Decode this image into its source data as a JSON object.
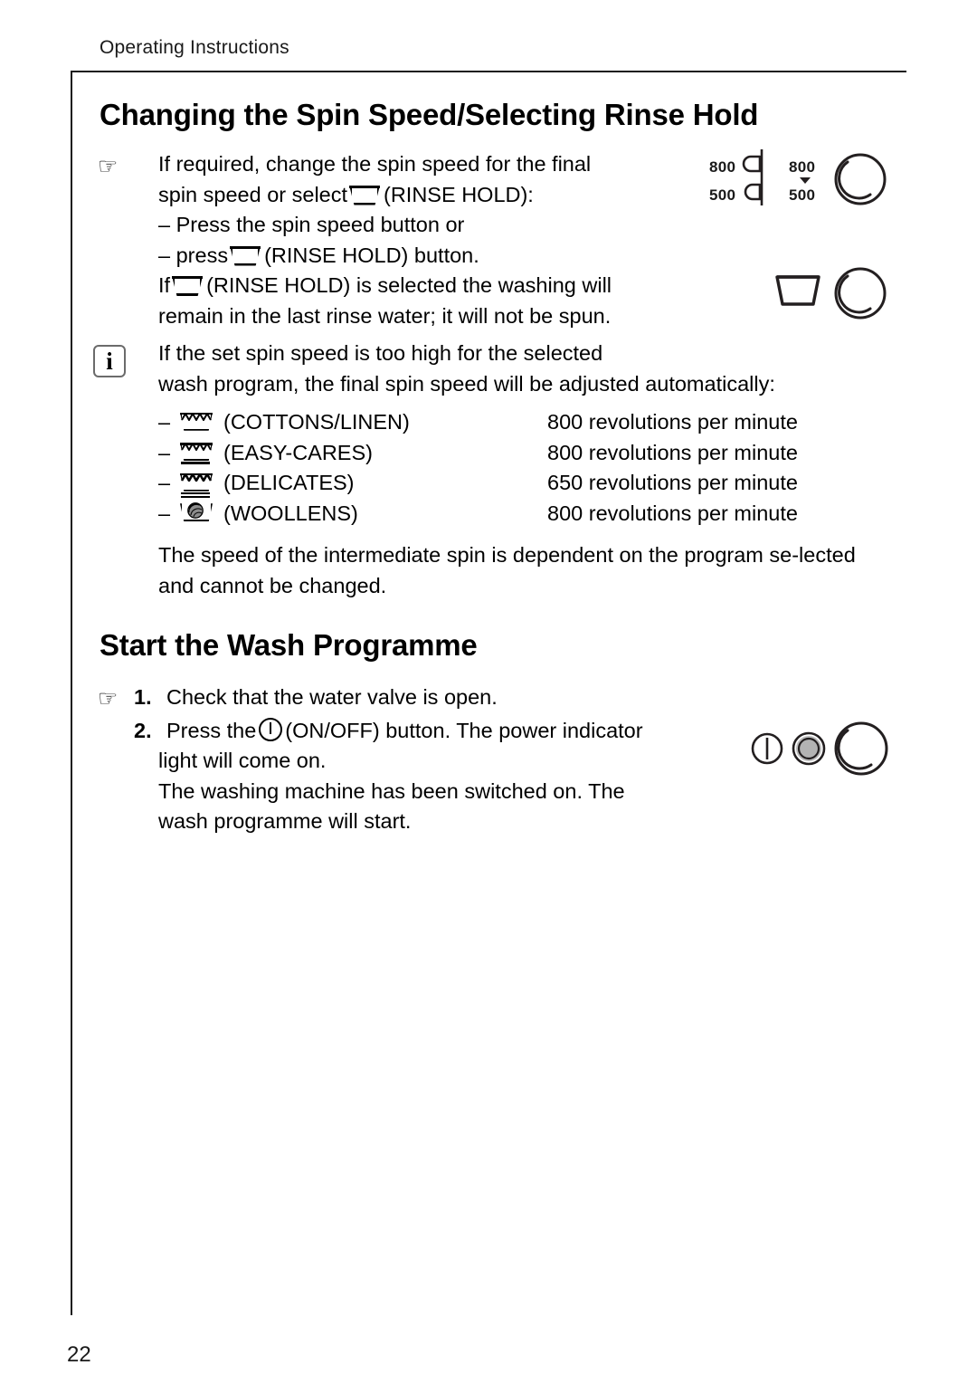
{
  "document": {
    "running_head": "Operating Instructions",
    "page_number": "22"
  },
  "sections": [
    {
      "heading": "Changing the Spin Speed/Selecting Rinse Hold"
    },
    {
      "heading": "Start the Wash Programme"
    }
  ],
  "spin_section": {
    "heading": "Changing the Spin Speed/Selecting Rinse Hold",
    "hand_icon": "pointing-hand-icon",
    "intro": {
      "line1": "If required, change the spin speed for the final",
      "line2_before": "spin speed or select",
      "line2_after": "(RINSE HOLD):",
      "bullet1": "– Press the spin speed button or",
      "bullet2_before": "– press",
      "bullet2_after": "(RINSE HOLD) button.",
      "note_line1_before": "If",
      "note_line1_after": "(RINSE HOLD) is selected the washing will",
      "note_line2": "remain in the last rinse water; it will not be spun."
    },
    "info_note": {
      "icon": "info-icon",
      "icon_letter": "i",
      "line1": "If the set spin speed is too high for the selected",
      "line2": "wash program, the final spin speed will be adjusted automatically:"
    },
    "speed_table": {
      "rows": [
        {
          "dash": "–",
          "symbol": "cottons-linen-icon",
          "label": "(COTTONS/LINEN)",
          "speed": "800 revolutions per minute"
        },
        {
          "dash": "–",
          "symbol": "easy-cares-icon",
          "label": "(EASY-CARES)",
          "speed": "800 revolutions per minute"
        },
        {
          "dash": "–",
          "symbol": "delicates-icon",
          "label": "(DELICATES)",
          "speed": "650 revolutions per minute"
        },
        {
          "dash": "–",
          "symbol": "woollens-icon",
          "label": "(WOOLLENS)",
          "speed": "800 revolutions per minute"
        }
      ]
    },
    "closing_paragraph": "The speed of the intermediate spin is dependent on the program se-lected and cannot be changed."
  },
  "start_section": {
    "heading": "Start the Wash Programme",
    "hand_icon": "pointing-hand-icon",
    "steps": [
      {
        "number": "1.",
        "text": "Check that the water valve is open."
      },
      {
        "number": "2.",
        "text_before": "Press the",
        "text_after": "(ON/OFF) button. The power indicator"
      }
    ],
    "step2_continued": "light will come on.",
    "step2_extra_line1": "The washing machine has been switched on. The",
    "step2_extra_line2": "wash programme will start."
  },
  "diagrams": {
    "spin_panel": {
      "side_view": {
        "label_top": "800",
        "label_bottom": "500",
        "name": "spin-speed-side-view"
      },
      "front_view": {
        "label_top": "800",
        "label_bottom": "500",
        "marker": "down-triangle-marker",
        "knob": "program-selector-knob"
      }
    },
    "rinse_hold_panel": {
      "tub": "rinse-hold-tub-icon",
      "knob": "program-selector-knob"
    },
    "power_panel": {
      "power_button": "on-off-power-icon",
      "indicator_light": "power-indicator-light",
      "knob": "program-selector-knob"
    }
  },
  "colors": {
    "ink": "#000000",
    "rule": "#1a1a1a",
    "diagram_stroke": "#231f20",
    "indicator_fill": "#b3b3b3",
    "info_border": "#6b6b6b"
  }
}
